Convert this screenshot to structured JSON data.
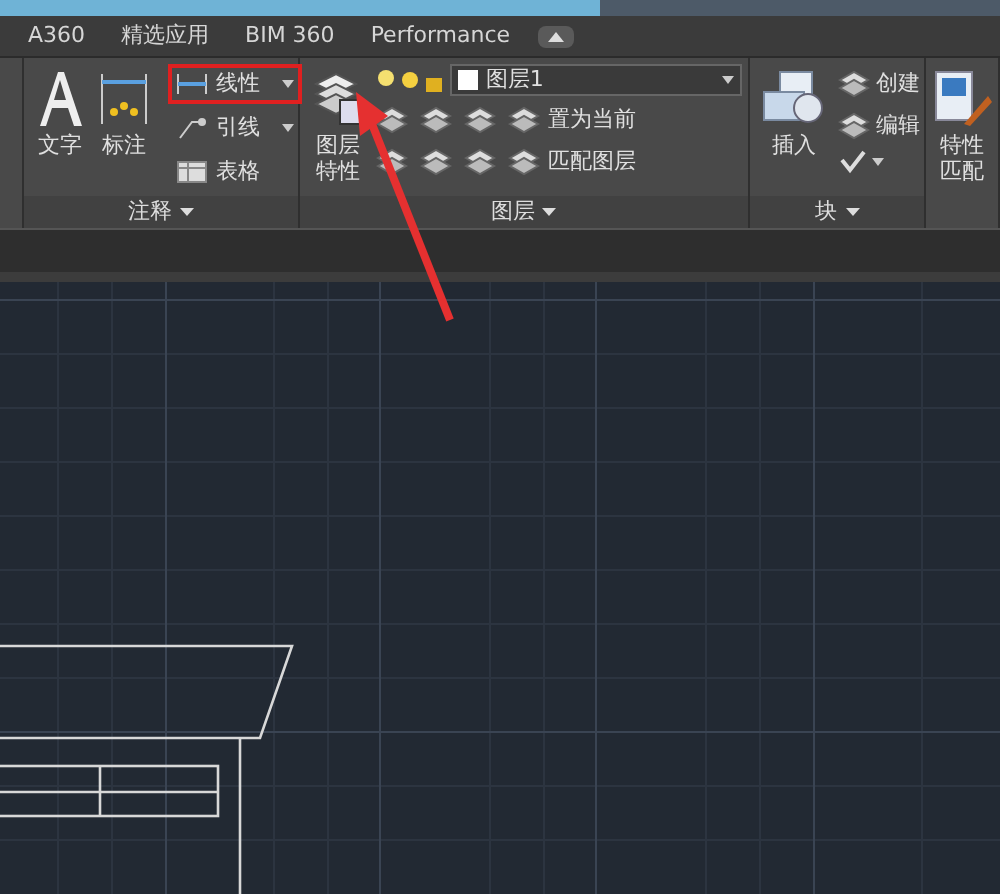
{
  "tabs": [
    {
      "label": "A360"
    },
    {
      "label": "精选应用"
    },
    {
      "label": "BIM 360"
    },
    {
      "label": "Performance"
    }
  ],
  "panels": [
    {
      "kind": "annotation",
      "title": "注释",
      "big_buttons": [
        "文字",
        "标注"
      ],
      "small_buttons": [
        {
          "label": "线性",
          "dropdown": true,
          "highlighted": true
        },
        {
          "label": "引线",
          "dropdown": true,
          "highlighted": false
        },
        {
          "label": "表格",
          "dropdown": false,
          "highlighted": false
        }
      ]
    },
    {
      "kind": "layers",
      "title": "图层",
      "big_button": "图层特性",
      "layer_value": "图层1",
      "small_buttons": [
        "置为当前",
        "匹配图层"
      ]
    },
    {
      "kind": "block",
      "title": "块",
      "big_button": "插入",
      "small_buttons": [
        "创建",
        "编辑"
      ]
    },
    {
      "kind": "match",
      "big_button": "特性匹配"
    }
  ]
}
